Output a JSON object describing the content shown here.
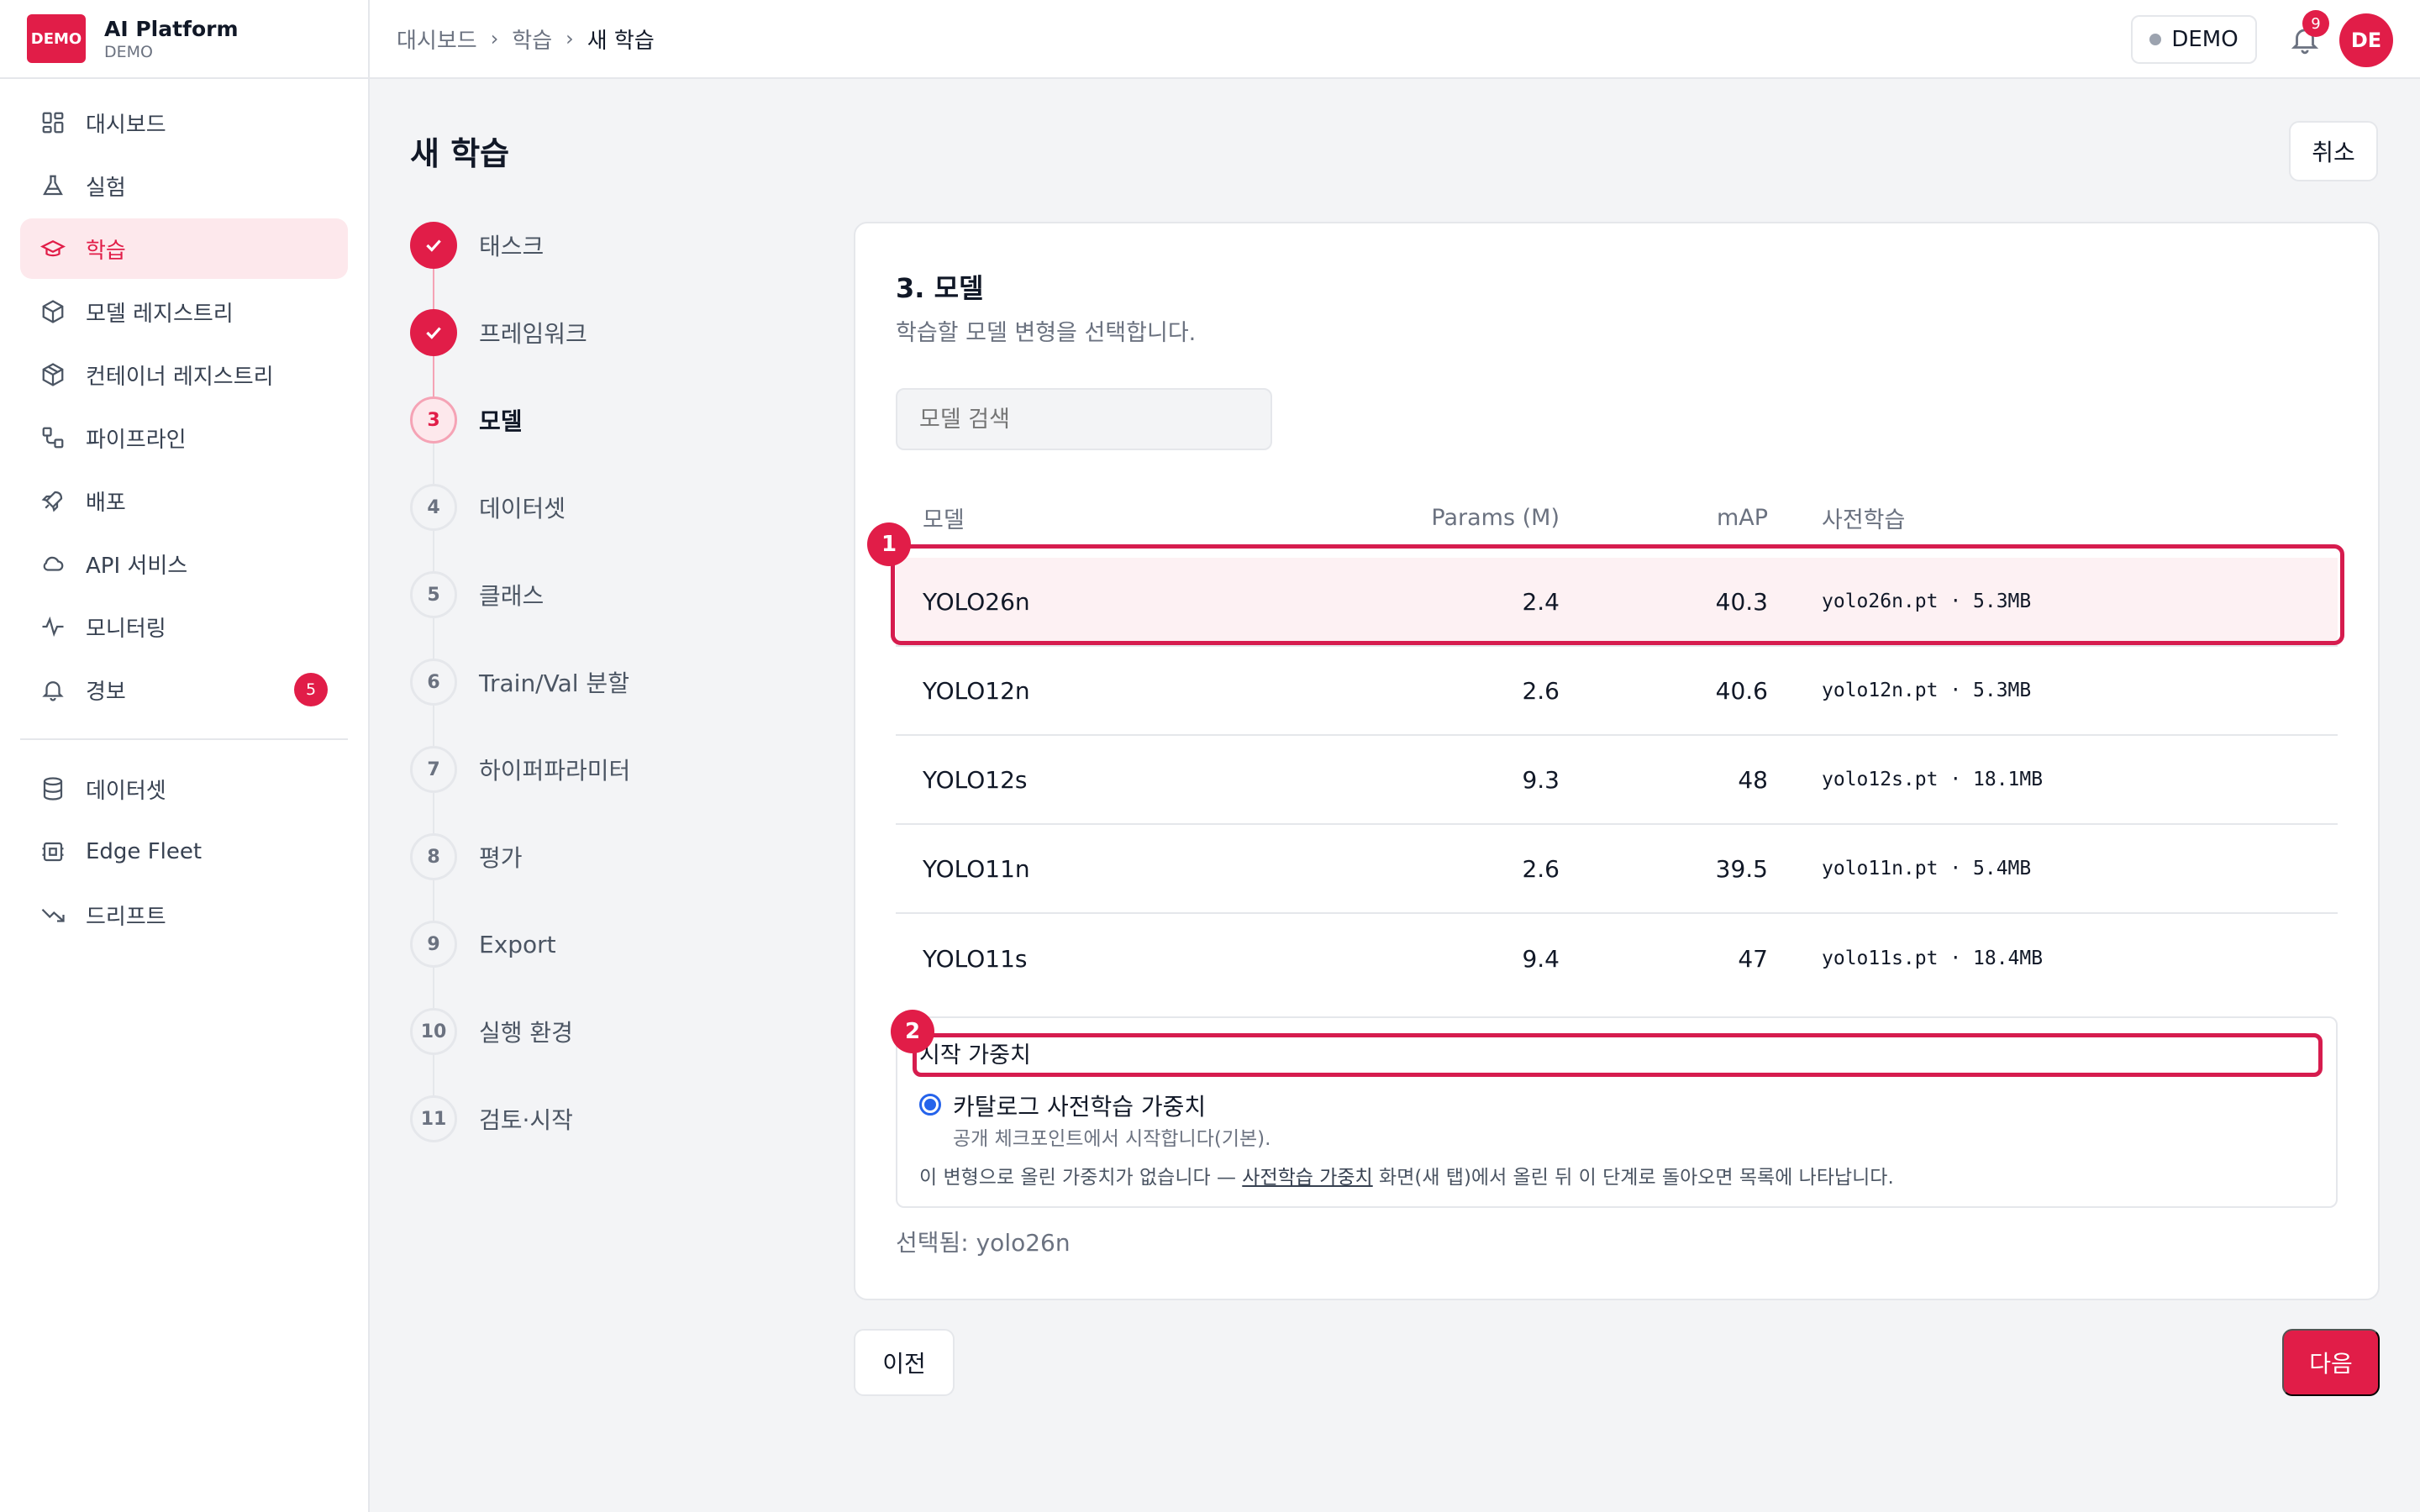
{
  "brand": {
    "logo_text": "DEMO",
    "title": "AI Platform",
    "subtitle": "DEMO"
  },
  "sidebar": {
    "items": [
      {
        "label": "대시보드",
        "icon": "dashboard-icon"
      },
      {
        "label": "실험",
        "icon": "flask-icon"
      },
      {
        "label": "학습",
        "icon": "graduation-cap-icon",
        "active": true
      },
      {
        "label": "모델 레지스트리",
        "icon": "cube-icon"
      },
      {
        "label": "컨테이너 레지스트리",
        "icon": "container-icon"
      },
      {
        "label": "파이프라인",
        "icon": "pipeline-icon"
      },
      {
        "label": "배포",
        "icon": "rocket-icon"
      },
      {
        "label": "API 서비스",
        "icon": "cloud-icon"
      },
      {
        "label": "모니터링",
        "icon": "activity-icon"
      },
      {
        "label": "경보",
        "icon": "bell-icon",
        "badge": "5"
      }
    ],
    "items2": [
      {
        "label": "데이터셋",
        "icon": "database-icon"
      },
      {
        "label": "Edge Fleet",
        "icon": "chip-icon"
      },
      {
        "label": "드리프트",
        "icon": "trending-down-icon"
      }
    ]
  },
  "header": {
    "breadcrumb": [
      "대시보드",
      "학습",
      "새 학습"
    ],
    "demo_label": "DEMO",
    "notif_count": "9",
    "avatar": "DE"
  },
  "page": {
    "title": "새 학습",
    "cancel": "취소"
  },
  "steps": [
    {
      "num": "",
      "label": "태스크",
      "state": "done"
    },
    {
      "num": "",
      "label": "프레임워크",
      "state": "done"
    },
    {
      "num": "3",
      "label": "모델",
      "state": "current"
    },
    {
      "num": "4",
      "label": "데이터셋",
      "state": "todo"
    },
    {
      "num": "5",
      "label": "클래스",
      "state": "todo"
    },
    {
      "num": "6",
      "label": "Train/Val 분할",
      "state": "todo"
    },
    {
      "num": "7",
      "label": "하이퍼파라미터",
      "state": "todo"
    },
    {
      "num": "8",
      "label": "평가",
      "state": "todo"
    },
    {
      "num": "9",
      "label": "Export",
      "state": "todo"
    },
    {
      "num": "10",
      "label": "실행 환경",
      "state": "todo"
    },
    {
      "num": "11",
      "label": "검토·시작",
      "state": "todo"
    }
  ],
  "card": {
    "title": "3. 모델",
    "desc": "학습할 모델 변형을 선택합니다.",
    "search_placeholder": "모델 검색",
    "columns": [
      "모델",
      "Params (M)",
      "mAP",
      "사전학습"
    ],
    "rows": [
      {
        "model": "YOLO26n",
        "params": "2.4",
        "map": "40.3",
        "pre": "yolo26n.pt · 5.3MB",
        "selected": true
      },
      {
        "model": "YOLO12n",
        "params": "2.6",
        "map": "40.6",
        "pre": "yolo12n.pt · 5.3MB"
      },
      {
        "model": "YOLO12s",
        "params": "9.3",
        "map": "48",
        "pre": "yolo12s.pt · 18.1MB"
      },
      {
        "model": "YOLO11n",
        "params": "2.6",
        "map": "39.5",
        "pre": "yolo11n.pt · 5.4MB"
      },
      {
        "model": "YOLO11s",
        "params": "9.4",
        "map": "47",
        "pre": "yolo11s.pt · 18.4MB"
      }
    ],
    "marks": [
      "1",
      "2"
    ],
    "weights": {
      "title": "시작 가중치",
      "option": "카탈로그 사전학습 가중치",
      "option_sub": "공개 체크포인트에서 시작합니다(기본).",
      "note_before": "이 변형으로 올린 가중치가 없습니다 — ",
      "note_link": "사전학습 가중치",
      "note_after": " 화면(새 탭)에서 올린 뒤 이 단계로 돌아오면 목록에 나타납니다."
    },
    "selected": "선택됨: yolo26n"
  },
  "footer": {
    "prev": "이전",
    "next": "다음"
  },
  "colors": {
    "accent": "#e11d48",
    "accent_light": "#fde8ec",
    "radio": "#2563eb"
  }
}
